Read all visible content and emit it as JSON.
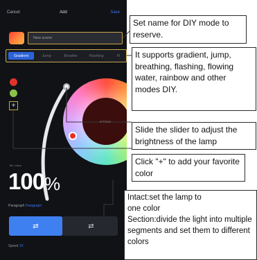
{
  "header": {
    "cancel": "Cancel",
    "title": "Add",
    "save": "Save"
  },
  "name_field": {
    "placeholder": "New scene"
  },
  "mode_tabs": [
    "Gradient",
    "Jump",
    "Breathe",
    "Flashing",
    "Fl"
  ],
  "color_wheel": {
    "center_label": "#FF0000"
  },
  "brightness": {
    "caption": "Brt. value",
    "value": "100",
    "unit": "%"
  },
  "paragraph": {
    "label": "Paragraph",
    "selected": "Paragraph"
  },
  "segments": {
    "left": "⇄",
    "right": "⇄"
  },
  "speed": {
    "label": "Speed",
    "value": "10"
  },
  "callouts": {
    "name": "Set name for DIY mode to reserve.",
    "modes": "It supports gradient, jump, breathing, flashing, flowing water, rainbow and other modes DIY.",
    "slider": "Slide the slider to adjust the brightness of the lamp",
    "add": "Click \"+\" to add your favorite color",
    "paragraph_l1": "Intact:set the lamp to",
    "paragraph_l2": "one color",
    "paragraph_l3": "Section:divide the light into multiple segments and set them to different colors"
  },
  "colors": {
    "accent": "#3b73ee",
    "highlight_border": "#c9a64b",
    "background": "#101216"
  }
}
